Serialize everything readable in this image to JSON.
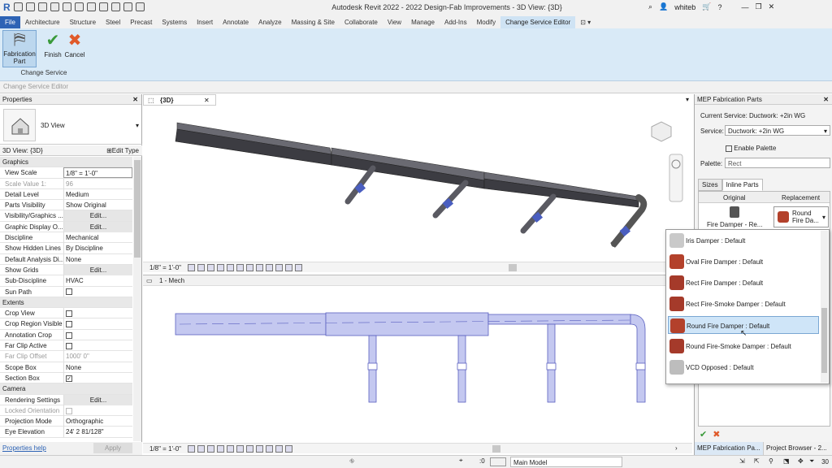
{
  "app": {
    "title": "Autodesk Revit 2022 - 2022 Design-Fab Improvements - 3D View: {3D}",
    "user": "whiteb",
    "logo": "R"
  },
  "ribbon_tabs": [
    "File",
    "Architecture",
    "Structure",
    "Steel",
    "Precast",
    "Systems",
    "Insert",
    "Annotate",
    "Analyze",
    "Massing & Site",
    "Collaborate",
    "View",
    "Manage",
    "Add-Ins",
    "Modify",
    "Change Service Editor"
  ],
  "ribbon": {
    "fabrication_part_label": "Fabrication Part",
    "finish_label": "Finish",
    "cancel_label": "Cancel",
    "panel_caption": "Change Service",
    "context_bar": "Change Service Editor"
  },
  "properties": {
    "title": "Properties",
    "type_name": "3D View",
    "instance_label": "3D View: {3D}",
    "edit_type": "Edit Type",
    "help": "Properties help",
    "apply": "Apply",
    "rows": [
      {
        "k": "Graphics",
        "v": "",
        "kind": "group"
      },
      {
        "k": "View Scale",
        "v": "1/8\" = 1'-0\"",
        "kind": "box"
      },
      {
        "k": "Scale Value    1:",
        "v": "96",
        "kind": "dim"
      },
      {
        "k": "Detail Level",
        "v": "Medium",
        "kind": "text"
      },
      {
        "k": "Parts Visibility",
        "v": "Show Original",
        "kind": "text"
      },
      {
        "k": "Visibility/Graphics ...",
        "v": "Edit...",
        "kind": "btn"
      },
      {
        "k": "Graphic Display O...",
        "v": "Edit...",
        "kind": "btn"
      },
      {
        "k": "Discipline",
        "v": "Mechanical",
        "kind": "text"
      },
      {
        "k": "Show Hidden Lines",
        "v": "By Discipline",
        "kind": "text"
      },
      {
        "k": "Default Analysis Di...",
        "v": "None",
        "kind": "text"
      },
      {
        "k": "Show Grids",
        "v": "Edit...",
        "kind": "btn"
      },
      {
        "k": "Sub-Discipline",
        "v": "HVAC",
        "kind": "text"
      },
      {
        "k": "Sun Path",
        "v": "",
        "kind": "check"
      },
      {
        "k": "Extents",
        "v": "",
        "kind": "group"
      },
      {
        "k": "Crop View",
        "v": "",
        "kind": "check"
      },
      {
        "k": "Crop Region Visible",
        "v": "",
        "kind": "check"
      },
      {
        "k": "Annotation Crop",
        "v": "",
        "kind": "check"
      },
      {
        "k": "Far Clip Active",
        "v": "",
        "kind": "check"
      },
      {
        "k": "Far Clip Offset",
        "v": "1000'  0\"",
        "kind": "dim"
      },
      {
        "k": "Scope Box",
        "v": "None",
        "kind": "text"
      },
      {
        "k": "Section Box",
        "v": "✓",
        "kind": "checked"
      },
      {
        "k": "Camera",
        "v": "",
        "kind": "group"
      },
      {
        "k": "Rendering Settings",
        "v": "Edit...",
        "kind": "btn"
      },
      {
        "k": "Locked Orientation",
        "v": "",
        "kind": "dimcheck"
      },
      {
        "k": "Projection Mode",
        "v": "Orthographic",
        "kind": "text"
      },
      {
        "k": "Eye Elevation",
        "v": "24'  2 81/128\"",
        "kind": "text"
      }
    ]
  },
  "view_top": {
    "tab": "{3D}",
    "scale": "1/8\" = 1'-0\""
  },
  "view_bottom": {
    "tab": "1 - Mech",
    "scale": "1/8\" = 1'-0\""
  },
  "mep": {
    "title": "MEP Fabrication Parts",
    "current_service_label": "Current Service:",
    "current_service": "Ductwork: +2in WG",
    "service_label": "Service:",
    "service_value": "Ductwork: +2in WG",
    "enable_palette": "Enable Palette",
    "palette_label": "Palette:",
    "palette_value": "Rect",
    "tab_sizes": "Sizes",
    "tab_inline": "Inline Parts",
    "col_original": "Original",
    "col_replacement": "Replacement",
    "orig_item": "Fire Damper - Re...",
    "repl_item": "Round Fire Da...",
    "footer_tabs": [
      "MEP Fabrication Pa...",
      "Project Browser - 2..."
    ]
  },
  "dropdown_items": [
    {
      "label": "Iris Damper : Default",
      "color": "#c9c9c9"
    },
    {
      "label": "Oval Fire Damper : Default",
      "color": "#b3412b"
    },
    {
      "label": "Rect Fire Damper : Default",
      "color": "#a53a2a"
    },
    {
      "label": "Rect Fire-Smoke Damper : Default",
      "color": "#a53a2a"
    },
    {
      "label": "Round Fire Damper : Default",
      "color": "#b3412b",
      "selected": true
    },
    {
      "label": "Round Fire-Smoke Damper : Default",
      "color": "#a53a2a"
    },
    {
      "label": "VCD Opposed : Default",
      "color": "#bdbdbd"
    }
  ],
  "status": {
    "sel_count": ":0",
    "model": "Main Model",
    "filter_count": "30"
  },
  "colors": {
    "duct_dark": "#4a4a52",
    "duct_plan": "#c4c8f0",
    "duct_plan_stroke": "#5a60c0",
    "accent": "#2d63b5"
  }
}
